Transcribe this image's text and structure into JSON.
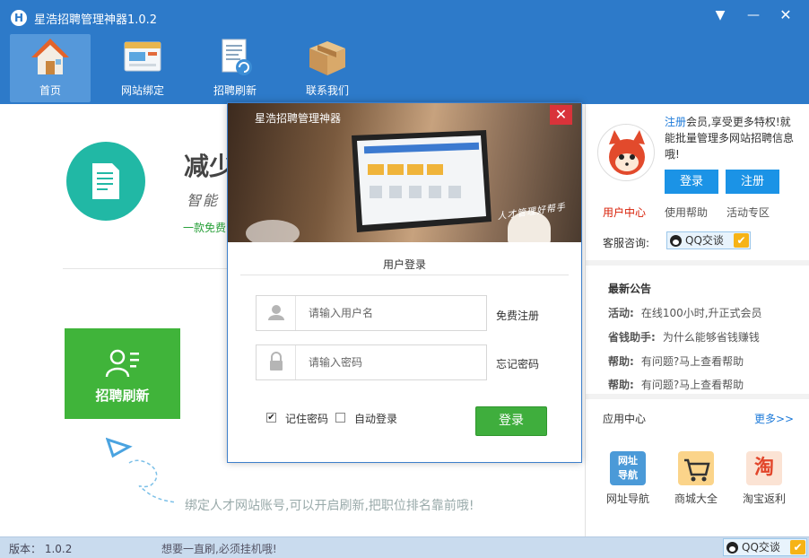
{
  "window": {
    "title": "星浩招聘管理神器1.0.2",
    "logo_letter": "H"
  },
  "nav": [
    {
      "label": "首页"
    },
    {
      "label": "网站绑定"
    },
    {
      "label": "招聘刷新"
    },
    {
      "label": "联系我们"
    }
  ],
  "main": {
    "headline": "减少",
    "subline": "智能",
    "greenline": "一款免费",
    "refresh_tile": "招聘刷新",
    "bottom_hint": "绑定人才网站账号,可以开启刷新,把职位排名靠前哦!"
  },
  "right": {
    "promo_register": "注册",
    "promo_text": "会员,享受更多特权!就能批量管理多网站招聘信息哦!",
    "login_btn": "登录",
    "register_btn": "注册",
    "link_user_center": "用户中心",
    "link_help": "使用帮助",
    "link_activity": "活动专区",
    "service_label": "客服咨询:",
    "qq_label": "QQ交谈",
    "notice_title": "最新公告",
    "notices": [
      {
        "tag": "活动:",
        "text": "在线100小时,升正式会员"
      },
      {
        "tag": "省钱助手:",
        "text": "为什么能够省钱赚钱"
      },
      {
        "tag": "帮助:",
        "text": "有问题?马上查看帮助"
      },
      {
        "tag": "帮助:",
        "text": "有问题?马上查看帮助"
      }
    ],
    "app_center": "应用中心",
    "more": "更多>>",
    "apps": [
      {
        "label": "网址导航",
        "icon": "网址导航",
        "color": "#4b9ad8"
      },
      {
        "label": "商城大全",
        "icon": "cart",
        "color": "#f5a623"
      },
      {
        "label": "淘宝返利",
        "icon": "淘",
        "color": "#e2462b"
      }
    ]
  },
  "modal": {
    "title": "星浩招聘管理神器",
    "slogan": "人才管理好帮手",
    "heading": "用户登录",
    "username_placeholder": "请输入用户名",
    "password_placeholder": "请输入密码",
    "free_register": "免费注册",
    "forgot_password": "忘记密码",
    "remember_label": "记住密码",
    "remember_checked": "✔",
    "auto_login_label": "自动登录",
    "login_button": "登录"
  },
  "status": {
    "version": "版本： 1.0.2",
    "message": "想要一直刷,必须挂机哦!",
    "qq_label": "QQ交谈"
  }
}
